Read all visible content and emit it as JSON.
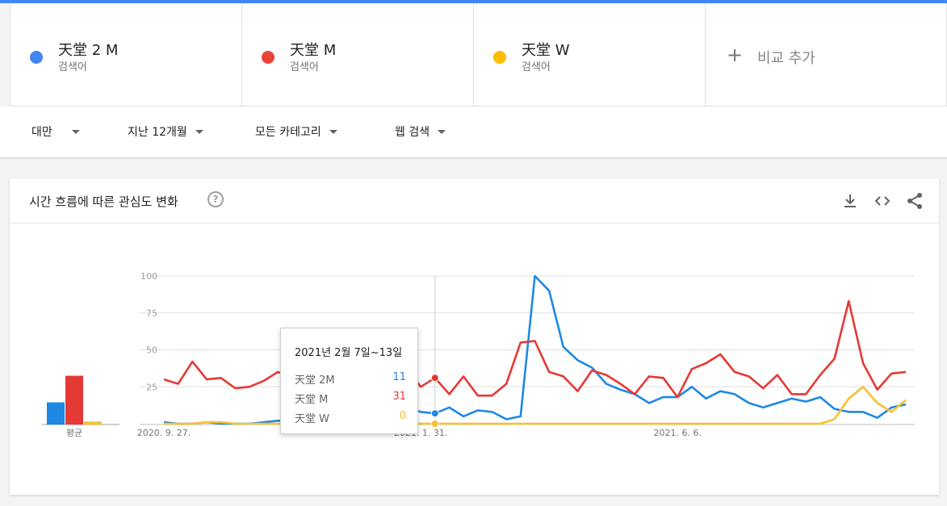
{
  "terms": [
    {
      "name": "天堂 2 M",
      "sub": "검색어",
      "color": "#4285f4"
    },
    {
      "name": "天堂 M",
      "sub": "검색어",
      "color": "#ea4335"
    },
    {
      "name": "天堂 W",
      "sub": "검색어",
      "color": "#fbbc04"
    }
  ],
  "add_compare": {
    "plus": "+",
    "label": "비교 추가"
  },
  "filters": {
    "region": "대만",
    "period": "지난 12개월",
    "category": "모든 카테고리",
    "search_type": "웹 검색"
  },
  "card": {
    "title": "시간 흐름에 따른 관심도 변화",
    "help": "?"
  },
  "header_icons": [
    "download-icon",
    "embed-code-icon",
    "share-icon"
  ],
  "tooltip": {
    "date": "2021년 2월 7일~13일",
    "rows": [
      {
        "term": "天堂 2M",
        "value": "11",
        "color": "#1e88e5"
      },
      {
        "term": "天堂 M",
        "value": "31",
        "color": "#e53935"
      },
      {
        "term": "天堂 W",
        "value": "0",
        "color": "#fbc02d"
      }
    ]
  },
  "chart_data": {
    "type": "line",
    "y_ticks": [
      "100",
      "75",
      "50",
      "25"
    ],
    "ylim": [
      0,
      100
    ],
    "x_tick_labels": [
      {
        "label": "2020. 9. 27.",
        "index": 0
      },
      {
        "label": "2021. 1. 31.",
        "index": 18
      },
      {
        "label": "2021. 6. 6.",
        "index": 36
      }
    ],
    "highlight_index": 19,
    "grid": true,
    "series": [
      {
        "name": "天堂 2 M",
        "color": "#1e88e5",
        "values": [
          1,
          0,
          0,
          1,
          0,
          0,
          0,
          1,
          2,
          1,
          1,
          2,
          1,
          1,
          2,
          13,
          13,
          11,
          8,
          7,
          11,
          5,
          9,
          8,
          3,
          5,
          100,
          90,
          52,
          43,
          38,
          27,
          23,
          20,
          14,
          18,
          18,
          25,
          17,
          22,
          20,
          14,
          11,
          14,
          17,
          15,
          18,
          10,
          8,
          8,
          4,
          11,
          13
        ]
      },
      {
        "name": "天堂 M",
        "color": "#e53935",
        "values": [
          30,
          27,
          42,
          30,
          31,
          24,
          25,
          29,
          35,
          31,
          40,
          47,
          30,
          28,
          27,
          32,
          36,
          38,
          25,
          31,
          20,
          32,
          19,
          19,
          27,
          55,
          56,
          35,
          32,
          22,
          36,
          33,
          27,
          20,
          32,
          31,
          18,
          37,
          41,
          47,
          35,
          32,
          24,
          33,
          20,
          20,
          33,
          44,
          83,
          41,
          23,
          34,
          35
        ]
      },
      {
        "name": "天堂 W",
        "color": "#fbc02d",
        "values": [
          0,
          0,
          0,
          1,
          1,
          0,
          0,
          0,
          0,
          0,
          0,
          0,
          0,
          0,
          0,
          0,
          0,
          0,
          0,
          0,
          0,
          0,
          0,
          0,
          0,
          0,
          0,
          0,
          0,
          0,
          0,
          0,
          0,
          0,
          0,
          0,
          0,
          0,
          0,
          0,
          0,
          0,
          0,
          0,
          0,
          0,
          0,
          3,
          17,
          25,
          14,
          8,
          16
        ]
      }
    ],
    "averages": {
      "label": "평균",
      "values": [
        15,
        33,
        2
      ]
    }
  }
}
